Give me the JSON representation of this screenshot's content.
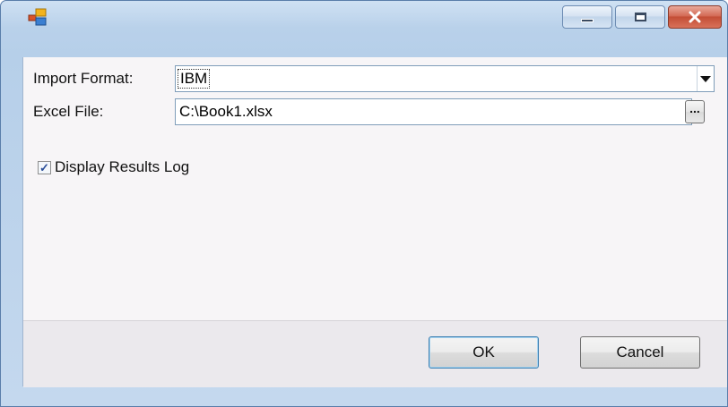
{
  "window": {
    "title": "",
    "icon": "app-form-icon",
    "caption_buttons": [
      "minimize-icon",
      "maximize-icon",
      "close-icon"
    ]
  },
  "form": {
    "import_format_label": "Import Format:",
    "import_format_value": "IBM",
    "excel_file_label": "Excel File:",
    "excel_file_value": "C:\\Book1.xlsx",
    "browse_label": "...",
    "display_log_label": "Display Results Log",
    "display_log_checked": true
  },
  "buttons": {
    "ok_label": "OK",
    "cancel_label": "Cancel"
  },
  "colors": {
    "frame": "#b9d1ea",
    "client": "#f7f5f7",
    "close_button": "#c34e36",
    "default_button_border": "#3c7fb1"
  }
}
